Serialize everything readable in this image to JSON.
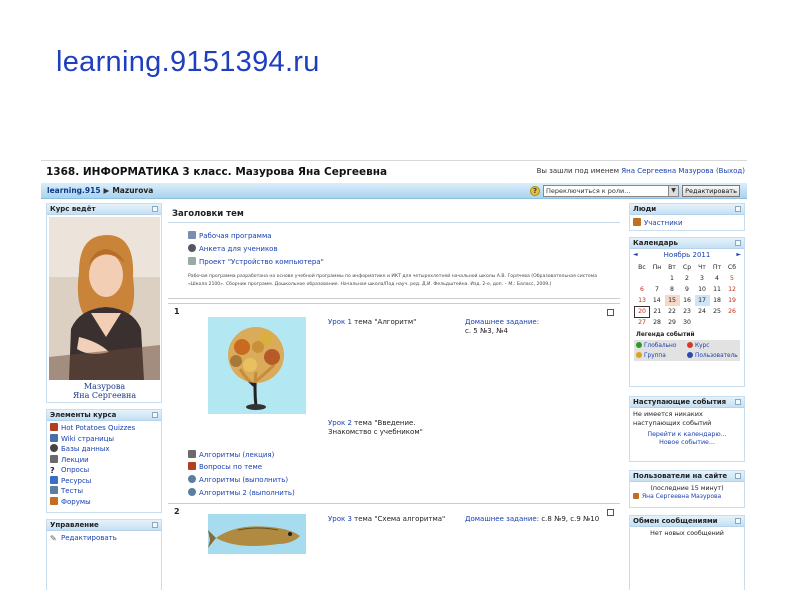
{
  "slide_title": "learning.9151394.ru",
  "colors": {
    "accent": "#1f3fbf",
    "link": "#1a40b0",
    "navbar": "#a9d3ee"
  },
  "header": {
    "course_title": "1368. ИНФОРМАТИКА 3 класс. Мазурова Яна Сергеевна",
    "login_prefix": "Вы зашли под именем",
    "login_user": "Яна Сергеевна Мазурова",
    "logout": "(Выход)"
  },
  "navbar": {
    "crumb_home": "learning.915",
    "crumb_sep": "▶",
    "crumb_current": "Mazurova",
    "role_select": "Переключиться к роли...",
    "edit_button": "Редактировать",
    "help_icon": "help-icon"
  },
  "left": {
    "teacher_block_title": "Курс ведёт",
    "teacher_name_line1": "Мазурова",
    "teacher_name_line2": "Яна Сергеевна",
    "elements_title": "Элементы курса",
    "elements": [
      {
        "label": "Hot Potatoes Quizzes",
        "icon": "hotpot-icon",
        "color": "#b04020"
      },
      {
        "label": "Wiki страницы",
        "icon": "wiki-icon",
        "color": "#4a6fa8"
      },
      {
        "label": "Базы данных",
        "icon": "database-icon",
        "color": "#444444"
      },
      {
        "label": "Лекции",
        "icon": "lesson-icon",
        "color": "#6a6a6a"
      },
      {
        "label": "Опросы",
        "icon": "choice-icon",
        "color": "#222222"
      },
      {
        "label": "Ресурсы",
        "icon": "resource-icon",
        "color": "#3a6fc8"
      },
      {
        "label": "Тесты",
        "icon": "quiz-icon",
        "color": "#5a7fa0"
      },
      {
        "label": "Форумы",
        "icon": "forum-icon",
        "color": "#c07020"
      }
    ],
    "admin_title": "Управление",
    "admin_items": [
      {
        "label": "Редактировать",
        "icon": "pencil-icon"
      }
    ]
  },
  "main": {
    "heading": "Заголовки тем",
    "section0": {
      "links": [
        "Рабочая программа",
        "Анкета для учеников",
        "Проект \"Устройство компьютера\""
      ],
      "description": "Рабочая программа разработана на основе учебной программы по информатике и ИКТ для четырехлетней начальной школы А.В. Горячева (Образовательная система «Школа 2100». Сборник программ. Дошкольное образование. Начальная школа/Под науч. ред. Д.И. Фельдштейна. Изд. 2-е, доп. – М.: Баласс, 2009.)"
    },
    "topic1": {
      "number": "1",
      "lesson1_link": "Урок 1",
      "lesson1_text": "тема \"Алгоритм\"",
      "homework_label": "Домашнее задание:",
      "homework_text": "с. 5 №3, №4",
      "lesson2_link": "Урок 2",
      "lesson2_text_line1": "тема \"Введение.",
      "lesson2_text_line2": "Знакомство с учебником\"",
      "activities": [
        "Алгоритмы (лекция)",
        "Вопросы по теме",
        "Алгоритмы (выполнить)",
        "Алгоритмы 2 (выполнить)"
      ]
    },
    "topic2": {
      "number": "2",
      "lesson3_link": "Урок 3",
      "lesson3_text": "тема \"Схема алгоритма\"",
      "homework_label": "Домашнее задание:",
      "homework_text": "с.8 №9, с.9 №10"
    }
  },
  "right": {
    "people_title": "Люди",
    "participants": "Участники",
    "calendar_title": "Календарь",
    "month": "Ноябрь 2011",
    "prev": "◄",
    "next": "►",
    "weekdays": [
      "Вс",
      "Пн",
      "Вт",
      "Ср",
      "Чт",
      "Пт",
      "Сб"
    ],
    "weeks": [
      [
        "",
        "",
        "1",
        "2",
        "3",
        "4",
        "5"
      ],
      [
        "6",
        "7",
        "8",
        "9",
        "10",
        "11",
        "12"
      ],
      [
        "13",
        "14",
        "15",
        "16",
        "17",
        "18",
        "19"
      ],
      [
        "20",
        "21",
        "22",
        "23",
        "24",
        "25",
        "26"
      ],
      [
        "27",
        "28",
        "29",
        "30",
        "",
        "",
        ""
      ]
    ],
    "legend_title": "Легенда событий",
    "legend": [
      {
        "label": "Глобально",
        "color": "#2a9a2a"
      },
      {
        "label": "Курс",
        "color": "#d23a2a"
      },
      {
        "label": "Группа",
        "color": "#e0a020"
      },
      {
        "label": "Пользователь",
        "color": "#2a4ab0"
      }
    ],
    "events_title": "Наступающие события",
    "events_none": "Не имеется никаких наступающих событий",
    "events_link1": "Перейти к календарю...",
    "events_link2": "Новое событие...",
    "online_title": "Пользователи на сайте",
    "online_period": "(последние 15 минут)",
    "online_user": "Яна Сергеевна Мазурова",
    "messages_title": "Обмен сообщениями",
    "messages_none": "Нет новых сообщений"
  }
}
